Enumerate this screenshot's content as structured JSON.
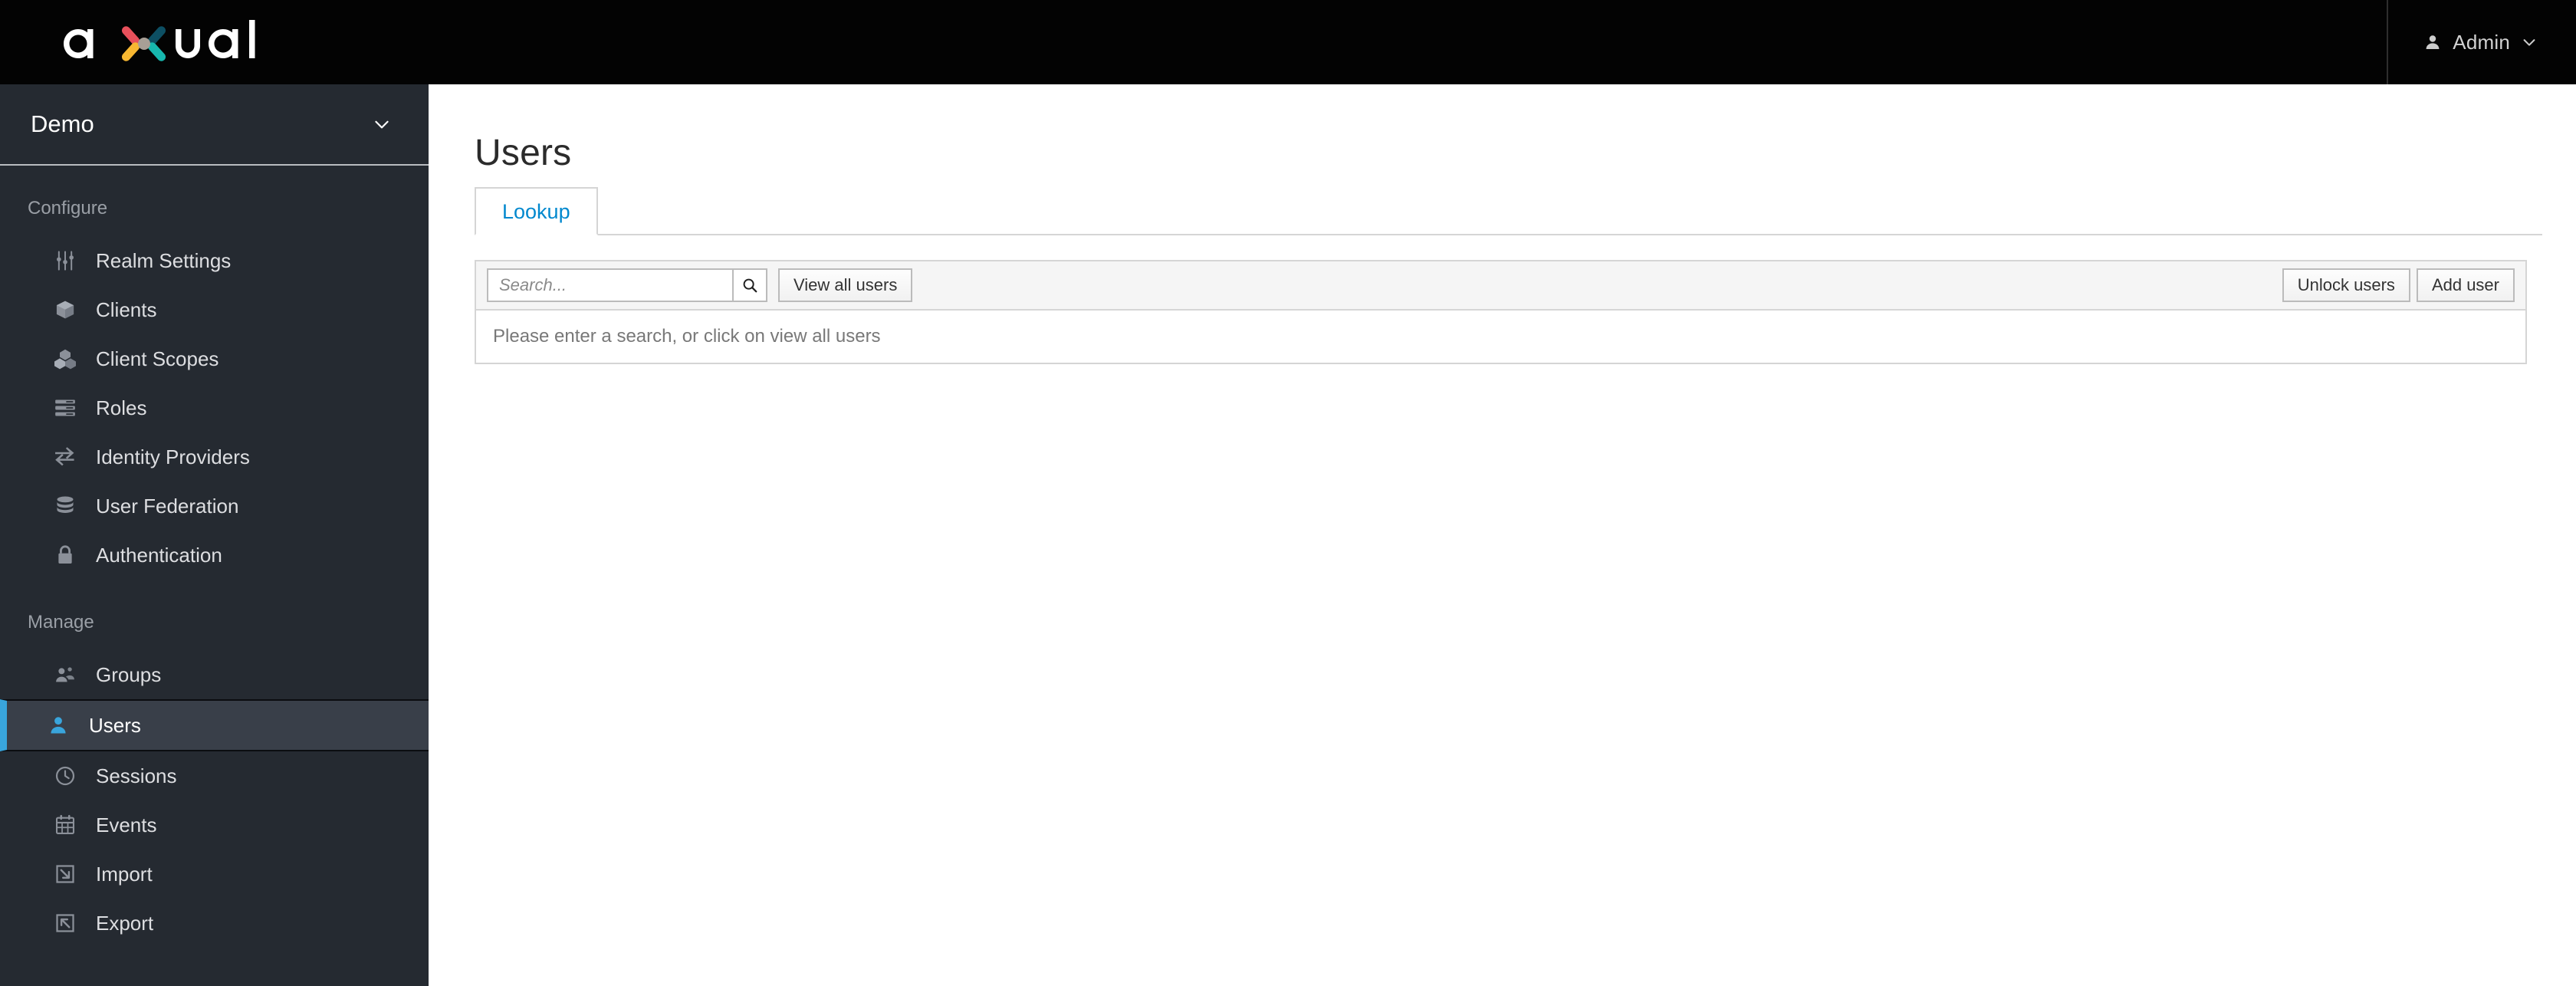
{
  "brand": {
    "logo_text": "axual",
    "logo_colors": {
      "top_left_arm": "#e8505b",
      "top_right_arm": "#0d4f63",
      "bottom_left_arm": "#f7b731",
      "bottom_right_arm": "#17b7ae",
      "center": "#a89f96",
      "wordmark": "#ffffff"
    }
  },
  "header": {
    "user_label": "Admin",
    "user_icon": "user-icon",
    "caret_icon": "chevron-down-icon"
  },
  "sidebar": {
    "realm": {
      "name": "Demo",
      "caret_icon": "chevron-down-icon"
    },
    "sections": [
      {
        "label": "Configure",
        "items": [
          {
            "label": "Realm Settings",
            "icon": "sliders-icon",
            "active": false
          },
          {
            "label": "Clients",
            "icon": "cube-icon",
            "active": false
          },
          {
            "label": "Client Scopes",
            "icon": "cubes-icon",
            "active": false
          },
          {
            "label": "Roles",
            "icon": "list-rows-icon",
            "active": false
          },
          {
            "label": "Identity Providers",
            "icon": "exchange-arrows-icon",
            "active": false
          },
          {
            "label": "User Federation",
            "icon": "database-icon",
            "active": false
          },
          {
            "label": "Authentication",
            "icon": "lock-icon",
            "active": false
          }
        ]
      },
      {
        "label": "Manage",
        "items": [
          {
            "label": "Groups",
            "icon": "users-group-icon",
            "active": false
          },
          {
            "label": "Users",
            "icon": "user-icon",
            "active": true
          },
          {
            "label": "Sessions",
            "icon": "clock-icon",
            "active": false
          },
          {
            "label": "Events",
            "icon": "calendar-icon",
            "active": false
          },
          {
            "label": "Import",
            "icon": "import-arrow-icon",
            "active": false
          },
          {
            "label": "Export",
            "icon": "export-arrow-icon",
            "active": false
          }
        ]
      }
    ],
    "accent_color": "#39a5dc"
  },
  "main": {
    "title": "Users",
    "tabs": [
      {
        "label": "Lookup",
        "active": true
      }
    ],
    "toolbar": {
      "search_value": "",
      "search_placeholder": "Search...",
      "search_icon": "search-icon",
      "view_all_users_label": "View all users",
      "unlock_users_label": "Unlock users",
      "add_user_label": "Add user"
    },
    "empty_message": "Please enter a search, or click on view all users"
  }
}
